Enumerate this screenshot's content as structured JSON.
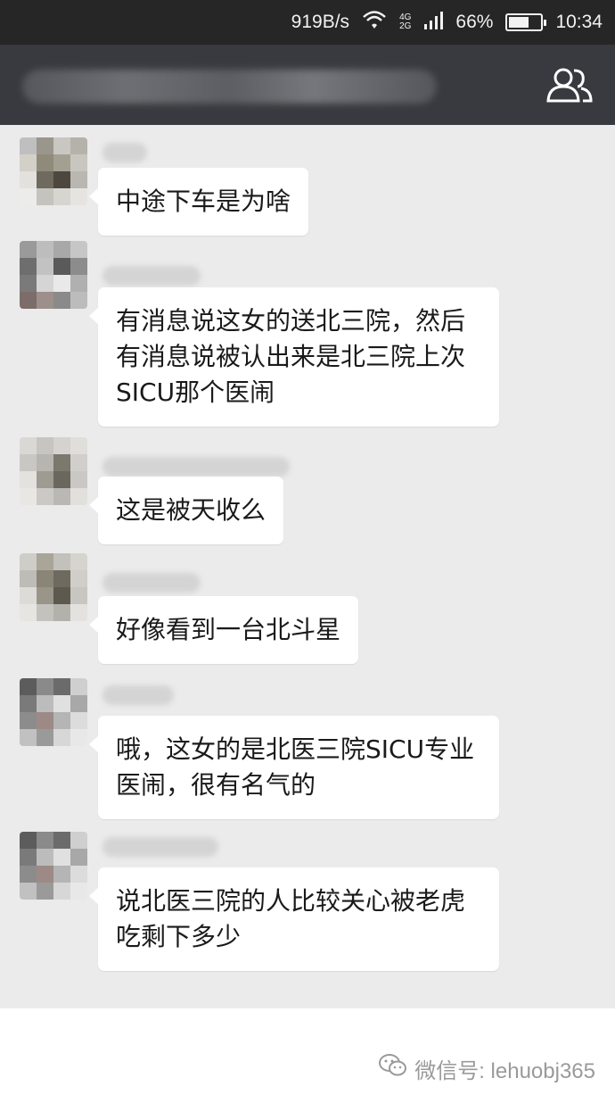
{
  "status_bar": {
    "speed": "919B/s",
    "wifi_icon": "wifi-icon",
    "network": "4G 2G",
    "signal_icon": "signal-icon",
    "battery_percent": "66%",
    "battery_level": 0.66,
    "time": "10:34"
  },
  "title_bar": {
    "group_icon": "group-members-icon"
  },
  "messages": [
    {
      "text": "中途下车是为啥"
    },
    {
      "text": "有消息说这女的送北三院，然后有消息说被认出来是北三院上次SICU那个医闹"
    },
    {
      "text": "这是被天收么"
    },
    {
      "text": "好像看到一台北斗星"
    },
    {
      "text": "哦，这女的是北医三院SICU专业医闹，很有名气的"
    },
    {
      "text": "说北医三院的人比较关心被老虎吃剩下多少"
    }
  ],
  "footer": {
    "watermark": "微信号: lehuobj365",
    "watermark_icon": "wechat-icon"
  },
  "colors": {
    "status_bar": "#262626",
    "title_bar": "#393a3f",
    "chat_bg": "#ebebeb",
    "bubble": "#ffffff"
  }
}
